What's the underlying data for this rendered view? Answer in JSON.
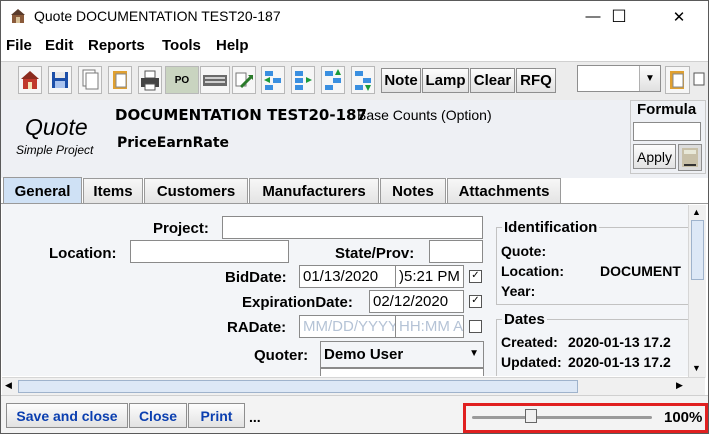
{
  "window": {
    "title": "Quote DOCUMENTATION TEST20-187",
    "minimize": "—",
    "maximize": "☐",
    "close": "✕"
  },
  "menu": [
    "File",
    "Edit",
    "Reports",
    "Tools",
    "Help"
  ],
  "toolbar": {
    "icon_buttons": [
      "home-icon",
      "save-icon",
      "copy-icon",
      "clipboard-icon",
      "print-icon",
      "po-icon",
      "keyboard-icon",
      "transfer-icon",
      "tree-left-icon",
      "tree-right-icon",
      "tree-up-icon",
      "tree-down-icon"
    ],
    "po_label": "PO",
    "text_buttons": [
      "Note",
      "Lamp",
      "Clear",
      "RFQ"
    ],
    "combo_value": ""
  },
  "header": {
    "type": "Quote",
    "subtype": "Simple Project",
    "name": "DOCUMENTATION TEST20-187",
    "base_counts": "Base Counts (Option)",
    "earn_rate": "PriceEarnRate",
    "formula_label": "Formula",
    "formula_value": "",
    "apply_label": "Apply"
  },
  "tabs": [
    {
      "label": "General",
      "active": true
    },
    {
      "label": "Items"
    },
    {
      "label": "Customers"
    },
    {
      "label": "Manufacturers"
    },
    {
      "label": "Notes"
    },
    {
      "label": "Attachments"
    }
  ],
  "form": {
    "project_label": "Project:",
    "project_value": "",
    "location_label": "Location:",
    "location_value": "",
    "state_label": "State/Prov:",
    "state_value": "",
    "biddate_label": "BidDate:",
    "biddate_date": "01/13/2020",
    "biddate_time": ")5:21 PM",
    "biddate_checked": true,
    "expiration_label": "ExpirationDate:",
    "expiration_date": "02/12/2020",
    "expiration_checked": true,
    "radate_label": "RADate:",
    "radate_date_placeholder": "MM/DD/YYYY",
    "radate_time_placeholder": "HH:MM A",
    "radate_checked": false,
    "quoter_label": "Quoter:",
    "quoter_value": "Demo User"
  },
  "identification": {
    "title": "Identification",
    "quote_label": "Quote:",
    "location_label": "Location:",
    "location_value": "DOCUMENT",
    "year_label": "Year:"
  },
  "dates": {
    "title": "Dates",
    "created_label": "Created:",
    "created_value": "2020-01-13 17.2",
    "updated_label": "Updated:",
    "updated_value": "2020-01-13 17.2"
  },
  "bottom": {
    "save_close": "Save and close",
    "close": "Close",
    "print": "Print",
    "ellipsis": "...",
    "zoom": "100%",
    "zoom_fraction": 0.33
  },
  "colors": {
    "link_blue": "#0b3fb0",
    "active_tab": "#cfe1f5",
    "highlight": "#e02020"
  }
}
